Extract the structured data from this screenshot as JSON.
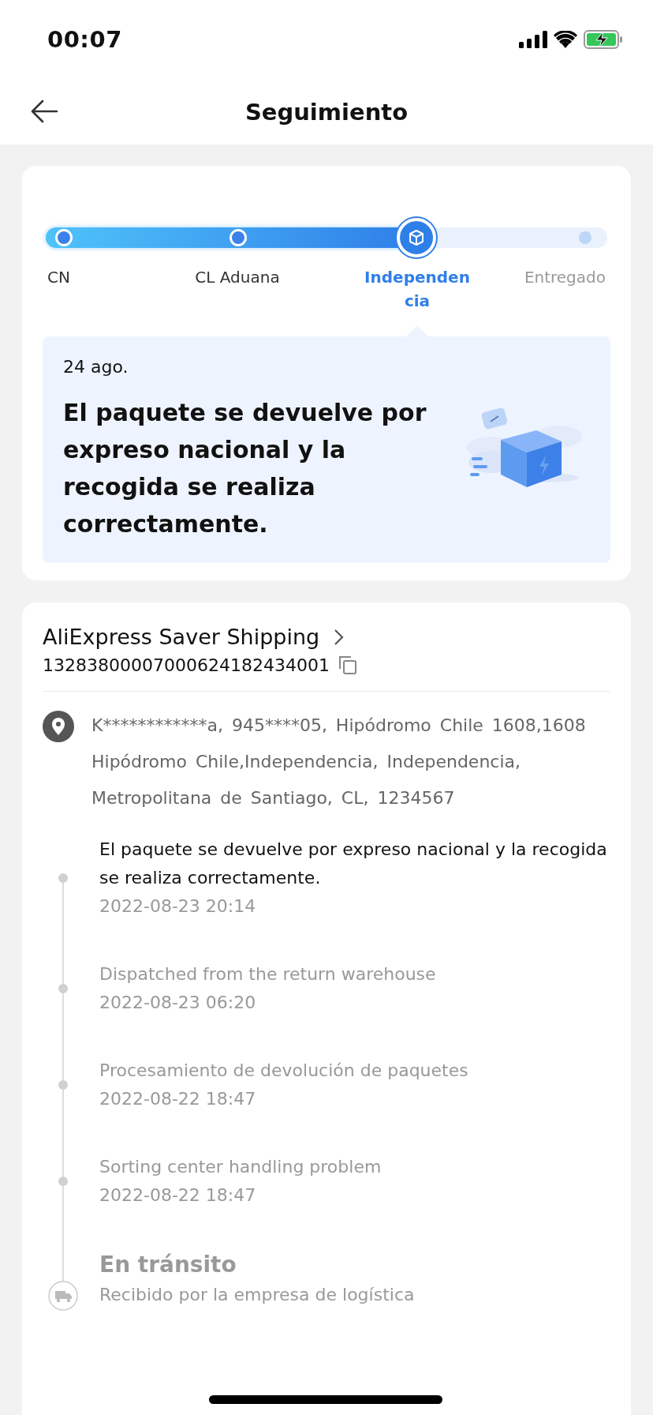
{
  "status_bar": {
    "time": "00:07"
  },
  "header": {
    "title": "Seguimiento"
  },
  "progress": {
    "level": 0.66,
    "stages": [
      {
        "label": "CN",
        "reached": true,
        "selected": false
      },
      {
        "label": "CL Aduana",
        "reached": true,
        "selected": false
      },
      {
        "label": "Independencia",
        "reached": true,
        "selected": true
      },
      {
        "label": "Entregado",
        "reached": false,
        "selected": false
      }
    ]
  },
  "latest": {
    "date": "24 ago.",
    "message": "El paquete se devuelve por expreso nacional y la recogida se realiza correctamente."
  },
  "shipment": {
    "carrier": "AliExpress Saver Shipping",
    "tracking_number": "13283800007000624182434001",
    "address": "K************a, 945****05, Hipódromo Chile 1608,1608 Hipódromo Chile,Independencia, Independencia, Metropolitana de Santiago, CL, 1234567"
  },
  "events": [
    {
      "kind": "event",
      "description": "El paquete se devuelve por expreso nacional y la recogida se realiza correctamente.",
      "time": "2022-08-23 20:14",
      "active": true
    },
    {
      "kind": "event",
      "description": "Dispatched from the return warehouse",
      "time": "2022-08-23 06:20",
      "active": false
    },
    {
      "kind": "event",
      "description": "Procesamiento de devolución de paquetes",
      "time": "2022-08-22 18:47",
      "active": false
    },
    {
      "kind": "event",
      "description": "Sorting center handling problem",
      "time": "2022-08-22 18:47",
      "active": false
    },
    {
      "kind": "milestone",
      "title": "En tránsito",
      "description": "Recibido por la empresa de logística"
    }
  ]
}
